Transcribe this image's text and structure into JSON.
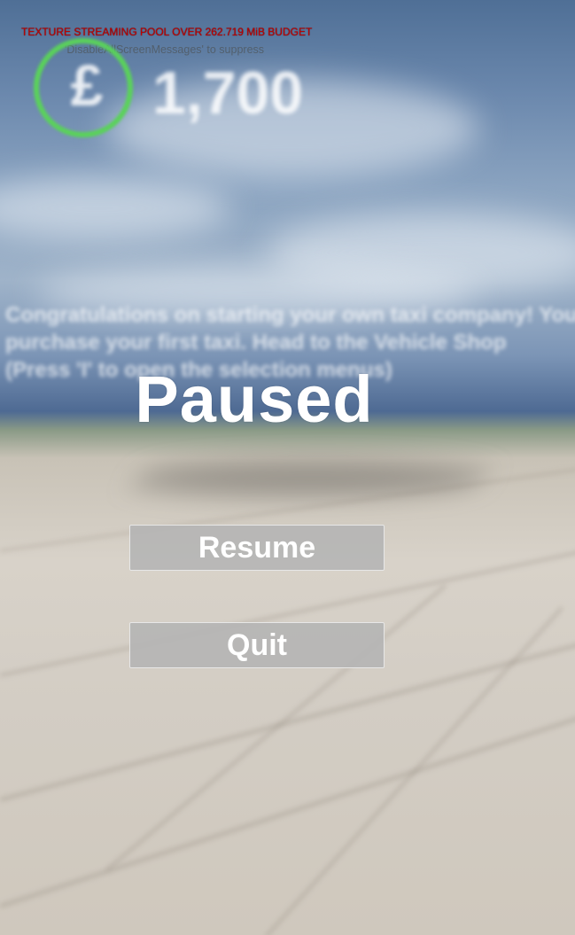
{
  "debug": {
    "warning": "TEXTURE STREAMING POOL OVER 262.719 MiB BUDGET",
    "hint": "'DisableAllScreenMessages' to suppress",
    "warning_color": "#c00000"
  },
  "hud": {
    "currency_icon": "pound-sign-icon",
    "currency_symbol": "£",
    "money": "1,700",
    "ring_color": "#5ad25a",
    "tutorial_text": "Congratulations on starting your own taxi company! You\npurchase your first taxi. Head to the Vehicle Shop\n(Press 'I' to  open the selection menus)"
  },
  "pause_menu": {
    "title": "Paused",
    "resume_label": "Resume",
    "quit_label": "Quit"
  }
}
